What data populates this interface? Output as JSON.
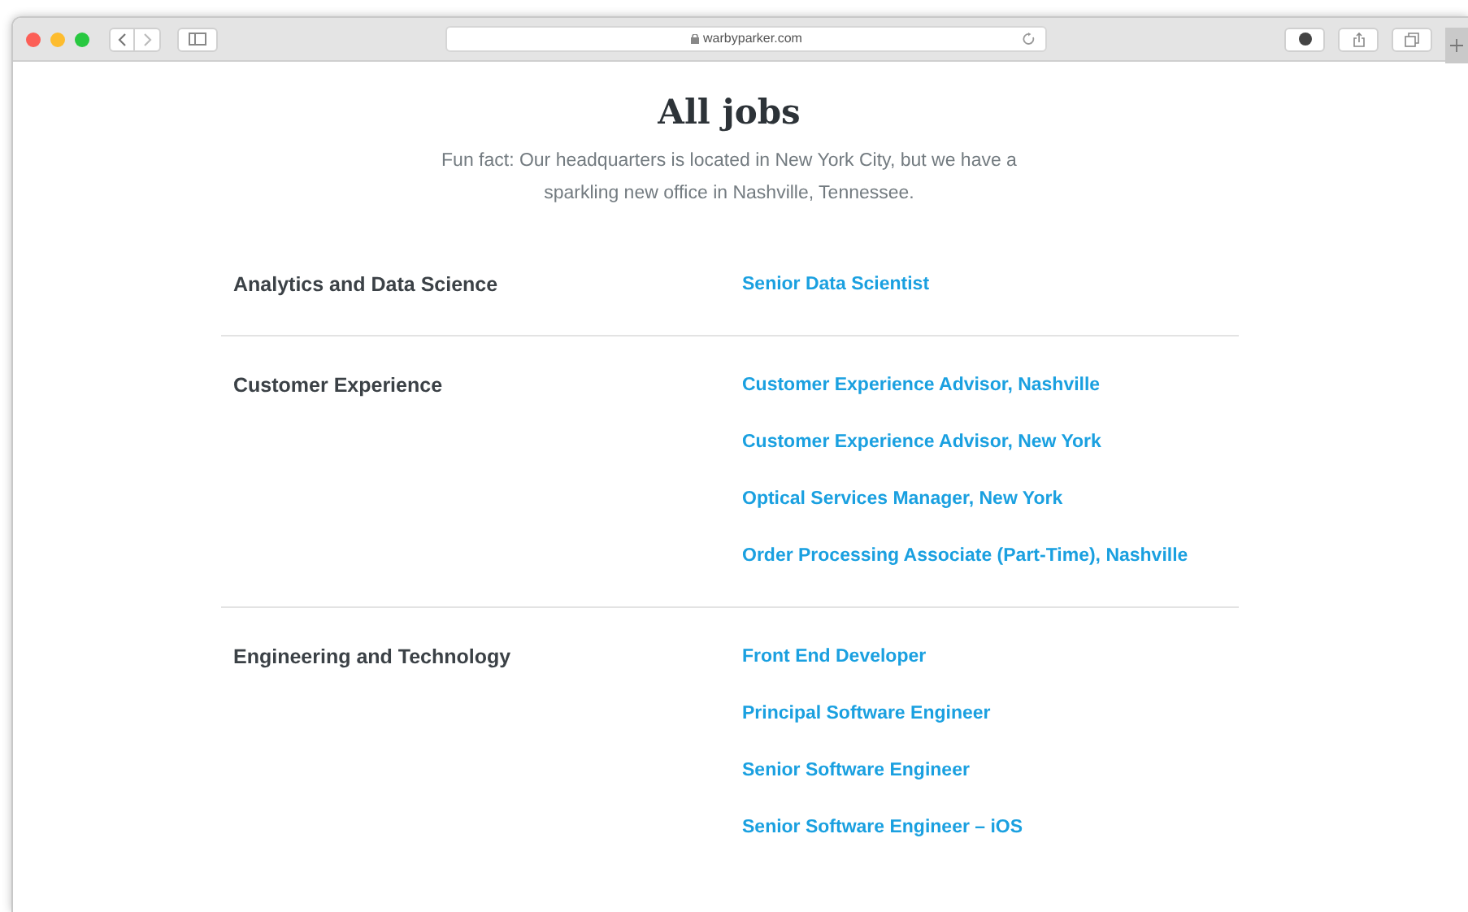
{
  "browser": {
    "url": "warbyparker.com"
  },
  "page": {
    "title": "All jobs",
    "intro": "Fun fact: Our headquarters is located in New York City, but we have a sparkling new office in Nashville, Tennessee."
  },
  "departments": [
    {
      "name": "Analytics and Data Science",
      "jobs": [
        "Senior Data Scientist"
      ]
    },
    {
      "name": "Customer Experience",
      "jobs": [
        "Customer Experience Advisor, Nashville",
        "Customer Experience Advisor, New York",
        "Optical Services Manager, New York",
        "Order Processing Associate (Part-Time), Nashville"
      ]
    },
    {
      "name": "Engineering and Technology",
      "jobs": [
        "Front End Developer",
        "Principal Software Engineer",
        "Senior Software Engineer",
        "Senior Software Engineer – iOS"
      ]
    }
  ]
}
